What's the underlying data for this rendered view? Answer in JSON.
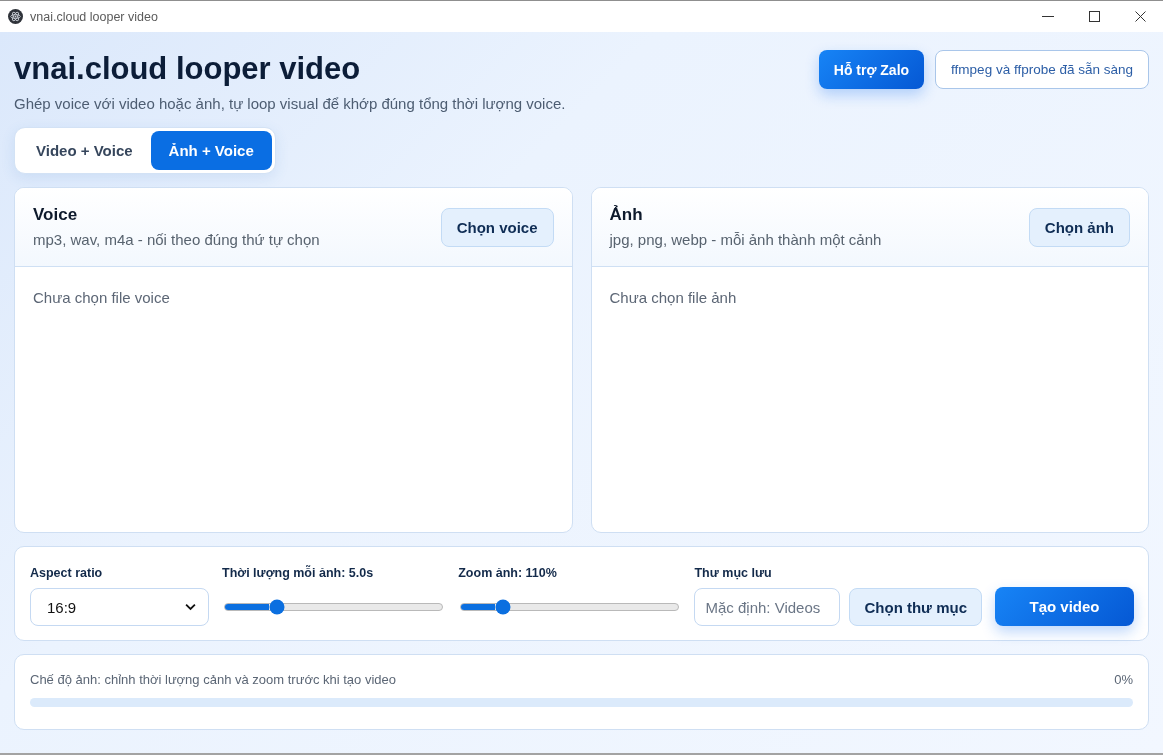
{
  "window": {
    "title": "vnai.cloud looper video"
  },
  "header": {
    "title": "vnai.cloud looper video",
    "subtitle": "Ghép voice với video hoặc ảnh, tự loop visual để khớp đúng tổng thời lượng voice.",
    "support_button": "Hỗ trợ Zalo",
    "status": "ffmpeg và ffprobe đã sẵn sàng"
  },
  "tabs": [
    {
      "label": "Video + Voice",
      "selected": false
    },
    {
      "label": "Ảnh + Voice",
      "selected": true
    }
  ],
  "panels": [
    {
      "title": "Voice",
      "description": "mp3, wav, m4a - nối theo đúng thứ tự chọn",
      "button": "Chọn voice",
      "empty_text": "Chưa chọn file voice"
    },
    {
      "title": "Ảnh",
      "description": "jpg, png, webp - mỗi ảnh thành một cảnh",
      "button": "Chọn ảnh",
      "empty_text": "Chưa chọn file ảnh"
    }
  ],
  "controls": {
    "aspect_ratio": {
      "label": "Aspect ratio",
      "value": "16:9"
    },
    "sliders": [
      {
        "label": "Thời lượng mỗi ảnh: 5.0s",
        "level": 0.24
      },
      {
        "label": "Zoom ảnh: 110%",
        "level": 0.19
      }
    ],
    "folder": {
      "label": "Thư mục lưu",
      "placeholder": "Mặc định: Videos",
      "button": "Chọn thư mục"
    },
    "create_button": "Tạo video"
  },
  "status": {
    "message": "Chế độ ảnh: chỉnh thời lượng cảnh và zoom trước khi tạo video",
    "percent": "0%",
    "level": 0
  }
}
